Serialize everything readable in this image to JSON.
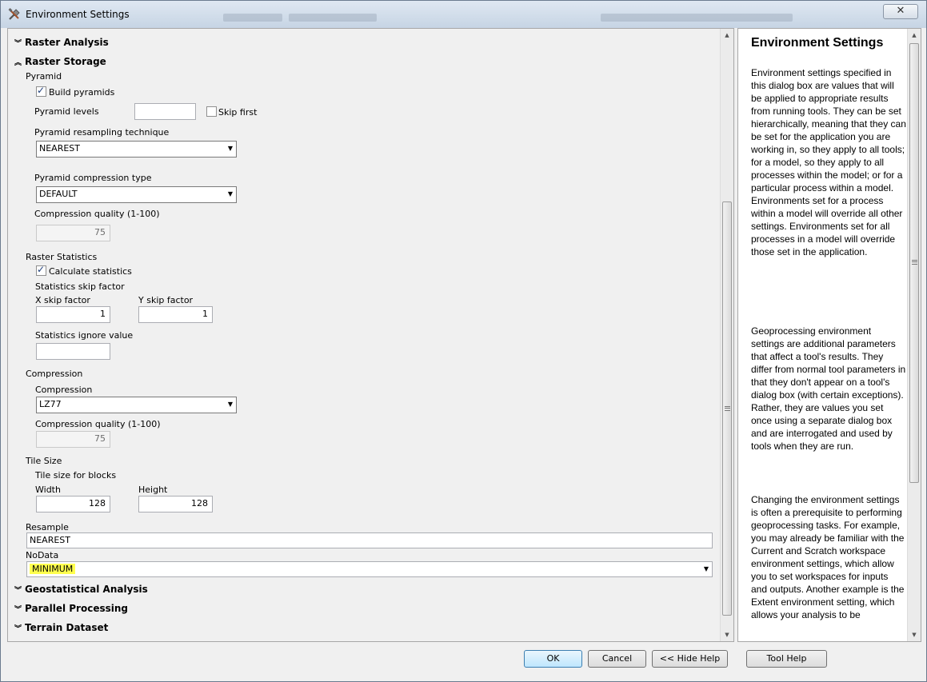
{
  "window": {
    "title": "Environment Settings"
  },
  "sections": {
    "raster_analysis": "Raster Analysis",
    "raster_storage": "Raster Storage",
    "geostatistical": "Geostatistical Analysis",
    "parallel": "Parallel Processing",
    "terrain": "Terrain Dataset"
  },
  "pyramid": {
    "group": "Pyramid",
    "build_label": "Build pyramids",
    "levels_label": "Pyramid levels",
    "levels_value": "",
    "skip_first_label": "Skip first",
    "resampling_label": "Pyramid resampling technique",
    "resampling_value": "NEAREST",
    "compression_type_label": "Pyramid compression type",
    "compression_type_value": "DEFAULT",
    "quality_label": "Compression quality (1-100)",
    "quality_value": "75"
  },
  "raster_statistics": {
    "group": "Raster Statistics",
    "calculate_label": "Calculate statistics",
    "skip_factor_label": "Statistics skip factor",
    "x_label": "X skip factor",
    "x_value": "1",
    "y_label": "Y skip factor",
    "y_value": "1",
    "ignore_label": "Statistics ignore value",
    "ignore_value": ""
  },
  "compression": {
    "group": "Compression",
    "label": "Compression",
    "value": "LZ77",
    "quality_label": "Compression quality (1-100)",
    "quality_value": "75"
  },
  "tile_size": {
    "group": "Tile Size",
    "blocks_label": "Tile size for blocks",
    "width_label": "Width",
    "width_value": "128",
    "height_label": "Height",
    "height_value": "128"
  },
  "resample": {
    "label": "Resample",
    "value": "NEAREST"
  },
  "nodata": {
    "label": "NoData",
    "value": "MINIMUM"
  },
  "help": {
    "title": "Environment Settings",
    "paragraphs": [
      "Environment settings specified in this dialog box are values that will be applied to appropriate results from running tools. They can be set hierarchically, meaning that they can be set for the application you are working in, so they apply to all tools; for a model, so they apply to all processes within the model; or for a particular process within a model. Environments set for a process within a model will override all other settings. Environments set for all processes in a model will override those set in the application.",
      "Geoprocessing environment settings are additional parameters that affect a tool's results. They differ from normal tool parameters in that they don't appear on a tool's dialog box (with certain exceptions). Rather, they are values you set once using a separate dialog box and are interrogated and used by tools when they are run.",
      "Changing the environment settings is often a prerequisite to performing geoprocessing tasks. For example, you may already be familiar with the Current and Scratch workspace environment settings, which allow you to set workspaces for inputs and outputs. Another example is the Extent environment setting, which allows your analysis to be"
    ]
  },
  "buttons": {
    "ok": "OK",
    "cancel": "Cancel",
    "hide_help": "<< Hide Help",
    "tool_help": "Tool Help"
  },
  "colors": {
    "highlight": "#ffff4d",
    "default_button": "#bee6fd"
  }
}
